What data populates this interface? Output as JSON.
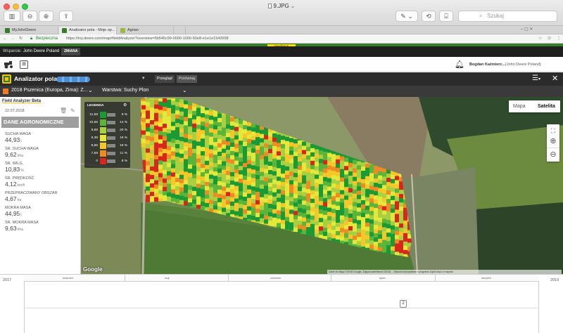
{
  "browser": {
    "window_title": "9.JPG",
    "search_placeholder": "Szukaj",
    "tabs": [
      {
        "label": "MyJohnDeere"
      },
      {
        "label": "Analizator pola - Moje op..."
      },
      {
        "label": "Agrian"
      }
    ],
    "url_secure": "Bezpieczna",
    "url": "https://my.deere.com/map#fieldAnalyzer?overview=5b545c99-0000-1000-50e8-e1e1e1542658"
  },
  "feedback_label": "Feedback",
  "jd_bar": {
    "org_label": "Wsparcie:",
    "org_name": "John Deere Poland",
    "change_label": "ZMIANA"
  },
  "user": {
    "name": "Bogdan Kaźmierc...",
    "org": "(John Deere Poland)"
  },
  "field_analyzer": {
    "title": "Analizator pola",
    "button_overview": "Przegląd",
    "button_compare": "Porównaj",
    "operation": "2018 Pszenica (Europa, Zima): Z...",
    "layer": "Warstwa: Suchy Plon"
  },
  "left_panel": {
    "beta_label": "Field Analyzer Beta",
    "date": "22.07.2018",
    "section_title": "DANE AGRONOMICZNE",
    "metrics": [
      {
        "label": "SUCHA WAGA",
        "value": "44,93",
        "unit": "t"
      },
      {
        "label": "ŚR. SUCHA WAGA",
        "value": "9,62",
        "unit": "t/ha"
      },
      {
        "label": "ŚR. WILG.",
        "value": "10,83",
        "unit": "%"
      },
      {
        "label": "ŚR. PRĘDKOŚĆ",
        "value": "4,12",
        "unit": "km/h"
      },
      {
        "label": "PRZEPRACOWANY OBSZAR",
        "value": "4,67",
        "unit": "ha"
      },
      {
        "label": "MOKRA MASA",
        "value": "44,95",
        "unit": "t"
      },
      {
        "label": "ŚR. MOKRA MASA",
        "value": "9,63",
        "unit": "t/ha"
      }
    ]
  },
  "map": {
    "toggle_map": "Mapa",
    "toggle_satellite": "Satelita",
    "google": "Google",
    "attribution": "Dane do Mapy ©2018 Google, Zdjęcia satelitarne ©2018 ... Warunki korzystania z programu  Zgłoś błąd w mapach"
  },
  "legend": {
    "title": "LEGENDA",
    "rows": [
      {
        "value": "11,58",
        "percent": "9 %",
        "color": "#1a9a35"
      },
      {
        "value": "10,56",
        "percent": "14 %",
        "color": "#5bb53a"
      },
      {
        "value": "9,88",
        "percent": "20 %",
        "color": "#a8d040"
      },
      {
        "value": "9,38",
        "percent": "19 %",
        "color": "#e3e83a"
      },
      {
        "value": "8,85",
        "percent": "19 %",
        "color": "#f7c72a"
      },
      {
        "value": "7,59",
        "percent": "11 %",
        "color": "#f08a24"
      },
      {
        "value": "0",
        "percent": "8 %",
        "color": "#d9261c"
      }
    ]
  },
  "timeline": {
    "year_left": "2017",
    "year_right": "2019",
    "months": [
      "kwiecień",
      "maj",
      "czerwiec",
      "lipiec",
      "sierpień"
    ],
    "marker": "2"
  }
}
